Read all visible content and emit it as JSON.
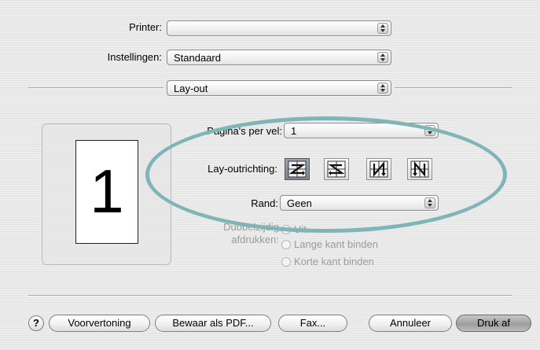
{
  "printer": {
    "label": "Printer:",
    "value": ""
  },
  "settings": {
    "label": "Instellingen:",
    "value": "Standaard"
  },
  "panel": {
    "value": "Lay-out"
  },
  "preview": {
    "page_number": "1"
  },
  "layout": {
    "pages_per_sheet_label": "Pagina's per vel:",
    "pages_per_sheet_value": "1",
    "direction_label": "Lay-outrichting:",
    "directions": [
      "z-direction-icon",
      "s-reverse-direction-icon",
      "n-reverse-direction-icon",
      "n-direction-icon"
    ],
    "selected_direction": 0,
    "border_label": "Rand:",
    "border_value": "Geen"
  },
  "duplex": {
    "label_line1": "Dubbelzijdig",
    "label_line2": "afdrukken:",
    "options": [
      "Uit",
      "Lange kant binden",
      "Korte kant binden"
    ],
    "selected": 0
  },
  "buttons": {
    "help": "?",
    "preview": "Voorvertoning",
    "save_pdf": "Bewaar als PDF...",
    "fax": "Fax...",
    "cancel": "Annuleer",
    "print": "Druk af"
  },
  "colors": {
    "highlight_ellipse": "#7fb5b7",
    "selected_direction_bg": "#8b94a2"
  }
}
